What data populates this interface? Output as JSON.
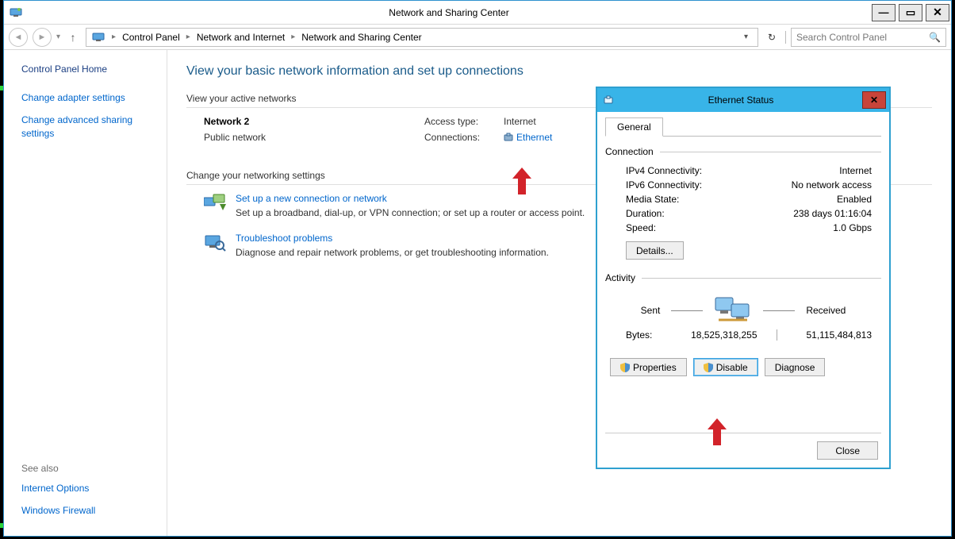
{
  "window": {
    "title": "Network and Sharing Center",
    "breadcrumbs": [
      "Control Panel",
      "Network and Internet",
      "Network and Sharing Center"
    ],
    "search_placeholder": "Search Control Panel"
  },
  "sidebar": {
    "home": "Control Panel Home",
    "links": [
      "Change adapter settings",
      "Change advanced sharing settings"
    ],
    "see_also_hdr": "See also",
    "see_also": [
      "Internet Options",
      "Windows Firewall"
    ]
  },
  "main": {
    "page_title": "View your basic network information and set up connections",
    "active_hdr": "View your active networks",
    "network": {
      "name": "Network  2",
      "type": "Public network",
      "access_label": "Access type:",
      "access_value": "Internet",
      "conn_label": "Connections:",
      "conn_value": "Ethernet"
    },
    "change_hdr": "Change your networking settings",
    "tasks": [
      {
        "title": "Set up a new connection or network",
        "desc": "Set up a broadband, dial-up, or VPN connection; or set up a router or access point."
      },
      {
        "title": "Troubleshoot problems",
        "desc": "Diagnose and repair network problems, or get troubleshooting information."
      }
    ]
  },
  "eth": {
    "title": "Ethernet Status",
    "tab": "General",
    "conn_hdr": "Connection",
    "rows": [
      {
        "k": "IPv4 Connectivity:",
        "v": "Internet"
      },
      {
        "k": "IPv6 Connectivity:",
        "v": "No network access"
      },
      {
        "k": "Media State:",
        "v": "Enabled"
      },
      {
        "k": "Duration:",
        "v": "238 days 01:16:04"
      },
      {
        "k": "Speed:",
        "v": "1.0 Gbps"
      }
    ],
    "details_btn": "Details...",
    "activity_hdr": "Activity",
    "sent_lbl": "Sent",
    "recv_lbl": "Received",
    "bytes_lbl": "Bytes:",
    "bytes_sent": "18,525,318,255",
    "bytes_recv": "51,115,484,813",
    "btns": {
      "properties": "Properties",
      "disable": "Disable",
      "diagnose": "Diagnose"
    },
    "close_btn": "Close"
  }
}
